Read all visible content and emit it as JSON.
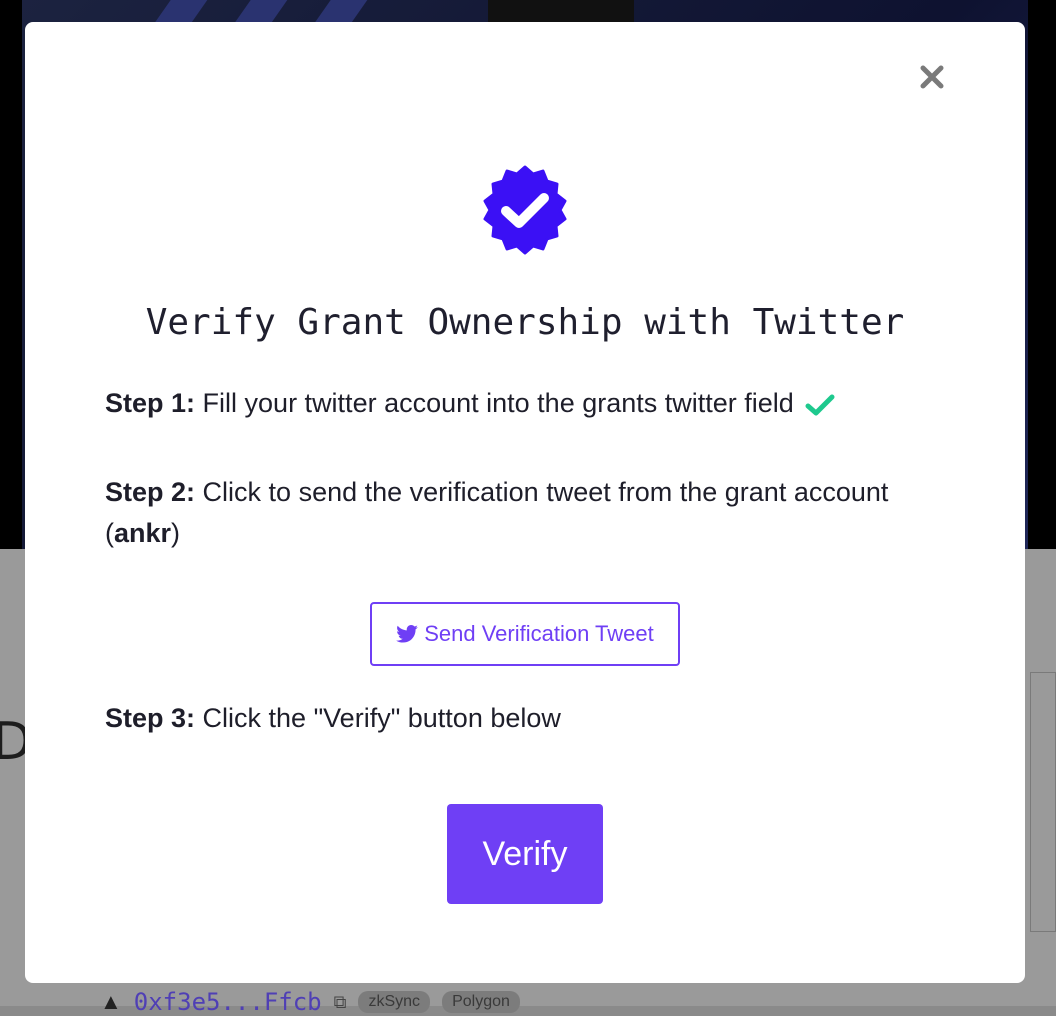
{
  "background": {
    "partial_heading": "D",
    "address": "0xf3e5...Ffcb",
    "tags": [
      "zkSync",
      "Polygon"
    ]
  },
  "modal": {
    "title": "Verify Grant Ownership with Twitter",
    "close_icon": "close-icon",
    "badge_icon": "verified-badge-icon",
    "steps": {
      "step1_label": "Step 1:",
      "step1_text": "Fill your twitter account into the grants twitter field",
      "step2_label": "Step 2:",
      "step2_text": "Click to send the verification tweet from the grant account",
      "step2_open": "(",
      "step2_account": "ankr",
      "step2_close": ")",
      "step3_label": "Step 3:",
      "step3_text": "Click the \"Verify\" button below"
    },
    "tweet_button_label": "Send Verification Tweet",
    "verify_button_label": "Verify"
  },
  "colors": {
    "accent": "#6f3ff5",
    "check": "#1ec98e",
    "badge": "#3b10f5"
  }
}
